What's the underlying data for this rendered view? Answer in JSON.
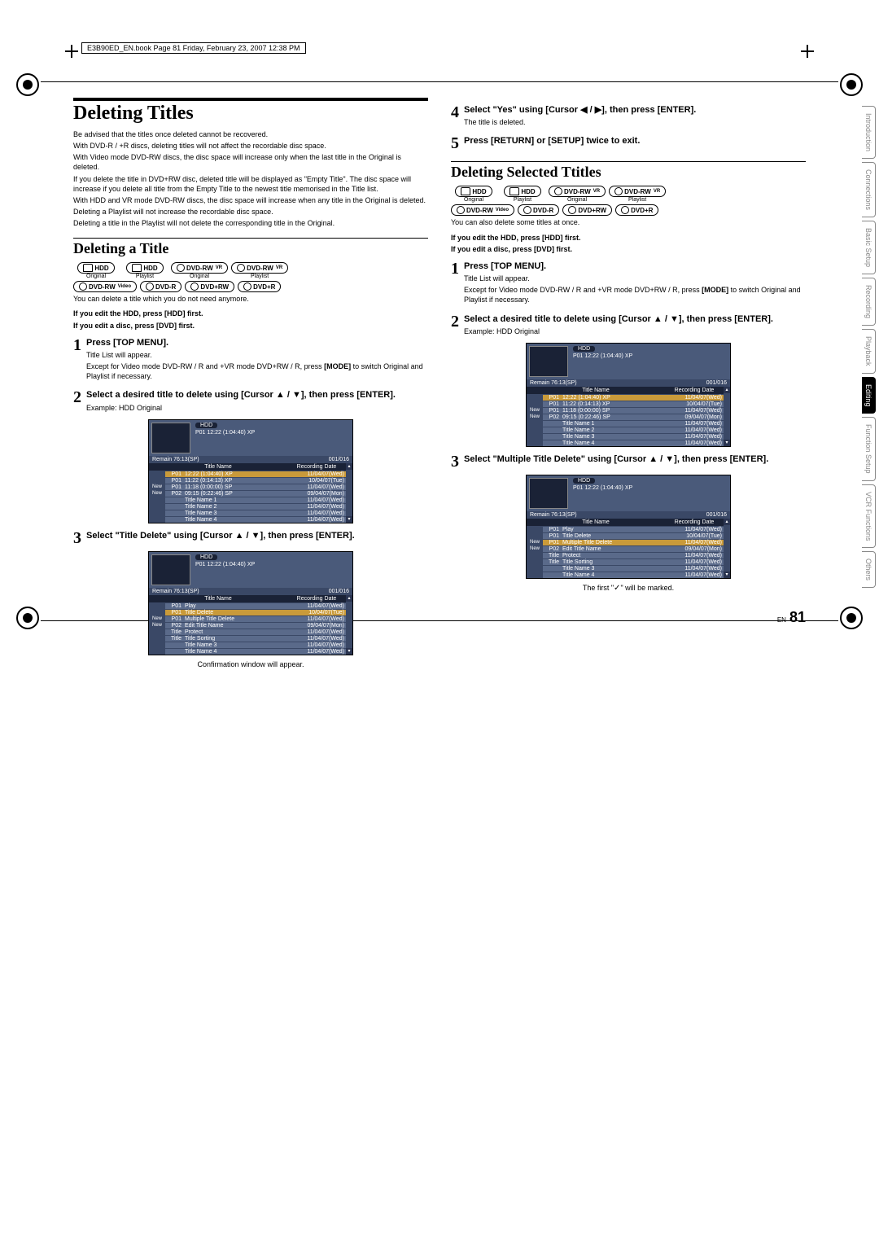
{
  "book_ref": "E3B90ED_EN.book  Page 81  Friday, February 23, 2007  12:38 PM",
  "page_number": "81",
  "page_prefix": "EN",
  "h1": "Deleting Titles",
  "intro": [
    "Be advised that the titles once deleted cannot be recovered.",
    "With DVD-R / +R discs, deleting titles will not affect the recordable disc space.",
    "With Video mode DVD-RW discs, the disc space will increase only when the last title in the Original is deleted.",
    "If you delete the title in DVD+RW disc, deleted title will be displayed as \"Empty Title\". The disc space will increase if you delete all title from the Empty Title to the newest title memorised in the Title list.",
    "With HDD and VR mode DVD-RW discs, the disc space will increase when any title in the Original is deleted.",
    "Deleting a Playlist will not increase the recordable disc space.",
    "Deleting a title in the Playlist will not delete the corresponding title in the Original."
  ],
  "h2_left": "Deleting a Title",
  "h2_right": "Deleting Selected Ttitles",
  "discs_row1": [
    {
      "label": "HDD",
      "sub": "Original"
    },
    {
      "label": "HDD",
      "sub": "Playlist"
    },
    {
      "label": "DVD-RW",
      "sup": "VR",
      "sub": "Original"
    },
    {
      "label": "DVD-RW",
      "sup": "VR",
      "sub": "Playlist"
    }
  ],
  "discs_row2": [
    {
      "label": "DVD-RW",
      "sup": "Video"
    },
    {
      "label": "DVD-R"
    },
    {
      "label": "DVD+RW"
    },
    {
      "label": "DVD+R"
    }
  ],
  "left_after_discs": "You can delete a title which you do not need anymore.",
  "right_after_discs": "You can also delete some titles at once.",
  "edit_note_hdd": "If you edit the HDD, press [HDD] first.",
  "edit_note_dvd": "If you edit a disc, press [DVD] first.",
  "steps_left": [
    {
      "n": "1",
      "h": "Press [TOP MENU].",
      "body": [
        "Title List will appear.",
        "Except for Video mode DVD-RW / R and +VR mode DVD+RW / R, press [MODE] to switch Original and Playlist if necessary."
      ]
    },
    {
      "n": "2",
      "h": "Select a desired title to delete using [Cursor ▲ / ▼], then press [ENTER].",
      "body": [
        "Example: HDD Original"
      ]
    },
    {
      "n": "3",
      "h": "Select \"Title Delete\" using [Cursor ▲ / ▼], then press [ENTER].",
      "body": []
    }
  ],
  "step3_caption": "Confirmation window will appear.",
  "steps_right_top": [
    {
      "n": "4",
      "h": "Select \"Yes\" using [Cursor ◀ / ▶], then press [ENTER].",
      "body": [
        "The title is deleted."
      ]
    },
    {
      "n": "5",
      "h": "Press [RETURN] or [SETUP] twice to exit.",
      "body": []
    }
  ],
  "steps_right_bot": [
    {
      "n": "1",
      "h": "Press [TOP MENU].",
      "body": [
        "Title List will appear.",
        "Except for Video mode DVD-RW / R and +VR mode DVD+RW / R, press [MODE] to switch Original and Playlist if necessary."
      ]
    },
    {
      "n": "2",
      "h": "Select a desired title to delete using [Cursor ▲ / ▼], then press [ENTER].",
      "body": [
        "Example: HDD Original"
      ]
    },
    {
      "n": "3",
      "h": "Select \"Multiple Title Delete\" using [Cursor ▲ / ▼], then press [ENTER].",
      "body": []
    }
  ],
  "step3r_caption": "The first \"✓\" will be marked.",
  "osd_common": {
    "hdd": "HDD",
    "p01": "P01  12:22 (1:04:40) XP",
    "remain": "Remain   76:13(SP)",
    "count": "001/016",
    "th_name": "Title Name",
    "th_date": "Recording Date"
  },
  "osd_title_rows": [
    {
      "tag": "",
      "p": "P01",
      "name": "12:22 (1:04:40) XP",
      "date": "11/04/07(Wed)",
      "active": true
    },
    {
      "tag": "",
      "p": "P01",
      "name": "11:22 (0:14:13) XP",
      "date": "10/04/07(Tue)"
    },
    {
      "tag": "New",
      "p": "P01",
      "name": "11:18 (0:00:00) SP",
      "date": "11/04/07(Wed)"
    },
    {
      "tag": "New",
      "p": "P02",
      "name": "09:15 (0:22:46) SP",
      "date": "09/04/07(Mon)"
    },
    {
      "tag": "",
      "p": "",
      "name": "Title Name 1",
      "date": "11/04/07(Wed)"
    },
    {
      "tag": "",
      "p": "",
      "name": "Title Name 2",
      "date": "11/04/07(Wed)"
    },
    {
      "tag": "",
      "p": "",
      "name": "Title Name 3",
      "date": "11/04/07(Wed)"
    },
    {
      "tag": "",
      "p": "",
      "name": "Title Name 4",
      "date": "11/04/07(Wed)"
    }
  ],
  "osd_menu_rows": [
    {
      "tag": "",
      "p": "P01",
      "name": "Play",
      "date": "11/04/07(Wed)"
    },
    {
      "tag": "",
      "p": "P01",
      "name": "Title Delete",
      "date": "10/04/07(Tue)",
      "active": true
    },
    {
      "tag": "New",
      "p": "P01",
      "name": "Multiple Title Delete",
      "date": "11/04/07(Wed)"
    },
    {
      "tag": "New",
      "p": "P02",
      "name": "Edit Title Name",
      "date": "09/04/07(Mon)"
    },
    {
      "tag": "",
      "p": "Title",
      "name": "Protect",
      "date": "11/04/07(Wed)"
    },
    {
      "tag": "",
      "p": "Title",
      "name": "Title Sorting",
      "date": "11/04/07(Wed)"
    },
    {
      "tag": "",
      "p": "",
      "name": "Title Name 3",
      "date": "11/04/07(Wed)"
    },
    {
      "tag": "",
      "p": "",
      "name": "Title Name 4",
      "date": "11/04/07(Wed)"
    }
  ],
  "osd_menu_rows_multi": [
    {
      "tag": "",
      "p": "P01",
      "name": "Play",
      "date": "11/04/07(Wed)"
    },
    {
      "tag": "",
      "p": "P01",
      "name": "Title Delete",
      "date": "10/04/07(Tue)"
    },
    {
      "tag": "New",
      "p": "P01",
      "name": "Multiple Title Delete",
      "date": "11/04/07(Wed)",
      "active": true
    },
    {
      "tag": "New",
      "p": "P02",
      "name": "Edit Title Name",
      "date": "09/04/07(Mon)"
    },
    {
      "tag": "",
      "p": "Title",
      "name": "Protect",
      "date": "11/04/07(Wed)"
    },
    {
      "tag": "",
      "p": "Title",
      "name": "Title Sorting",
      "date": "11/04/07(Wed)"
    },
    {
      "tag": "",
      "p": "",
      "name": "Title Name 3",
      "date": "11/04/07(Wed)"
    },
    {
      "tag": "",
      "p": "",
      "name": "Title Name 4",
      "date": "11/04/07(Wed)"
    }
  ],
  "sidetabs": [
    {
      "label": "Introduction"
    },
    {
      "label": "Connections"
    },
    {
      "label": "Basic Setup"
    },
    {
      "label": "Recording"
    },
    {
      "label": "Playback"
    },
    {
      "label": "Editing",
      "active": true
    },
    {
      "label": "Function Setup"
    },
    {
      "label": "VCR Functions"
    },
    {
      "label": "Others"
    }
  ]
}
